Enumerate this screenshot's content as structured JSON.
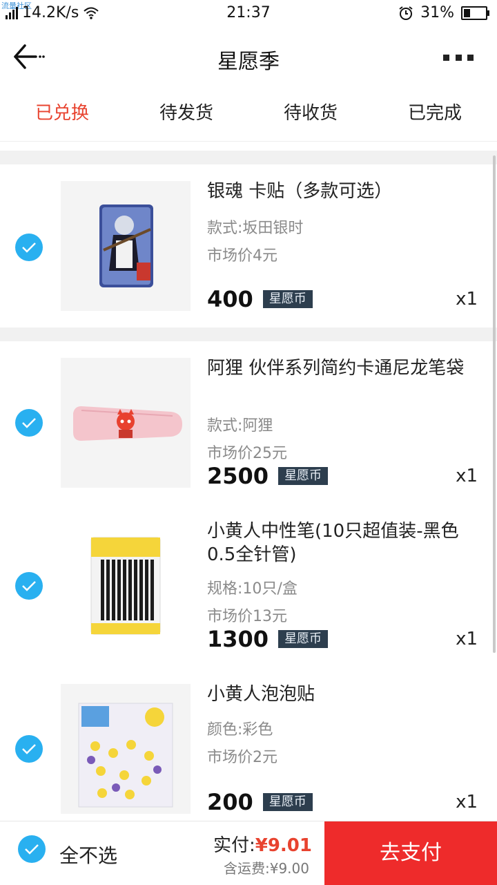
{
  "status_bar": {
    "watermark": "流量社区",
    "network": "4G",
    "speed": "14.2K/s",
    "time": "21:37",
    "battery": "31%",
    "battery_level": 0.31
  },
  "header": {
    "title": "星愿季"
  },
  "tabs": [
    {
      "label": "已兑换",
      "active": true
    },
    {
      "label": "待发货",
      "active": false
    },
    {
      "label": "待收货",
      "active": false
    },
    {
      "label": "已完成",
      "active": false
    }
  ],
  "items": [
    {
      "title": "银魂 卡贴（多款可选）",
      "attr": "款式:坂田银时",
      "market_price": "市场价4元",
      "price": "400",
      "currency": "星愿币",
      "qty": "x1",
      "checked": true
    },
    {
      "title": "阿狸 伙伴系列简约卡通尼龙笔袋",
      "attr": "款式:阿狸",
      "market_price": "市场价25元",
      "price": "2500",
      "currency": "星愿币",
      "qty": "x1",
      "checked": true
    },
    {
      "title": "小黄人中性笔(10只超值装-黑色0.5全针管)",
      "attr": "规格:10只/盒",
      "market_price": "市场价13元",
      "price": "1300",
      "currency": "星愿币",
      "qty": "x1",
      "checked": true
    },
    {
      "title": "小黄人泡泡贴",
      "attr": "颜色:彩色",
      "market_price": "市场价2元",
      "price": "200",
      "currency": "星愿币",
      "qty": "x1",
      "checked": true
    }
  ],
  "footer": {
    "select_all_label": "全不选",
    "pay_label": "实付:",
    "pay_amount": "¥9.01",
    "shipping": "含运费:¥9.00",
    "pay_button": "去支付"
  },
  "colors": {
    "accent_red": "#e8432f",
    "check_blue": "#29b0f0",
    "coin_tag_bg": "#2d3e4e",
    "pay_button_bg": "#ee2b2b"
  }
}
